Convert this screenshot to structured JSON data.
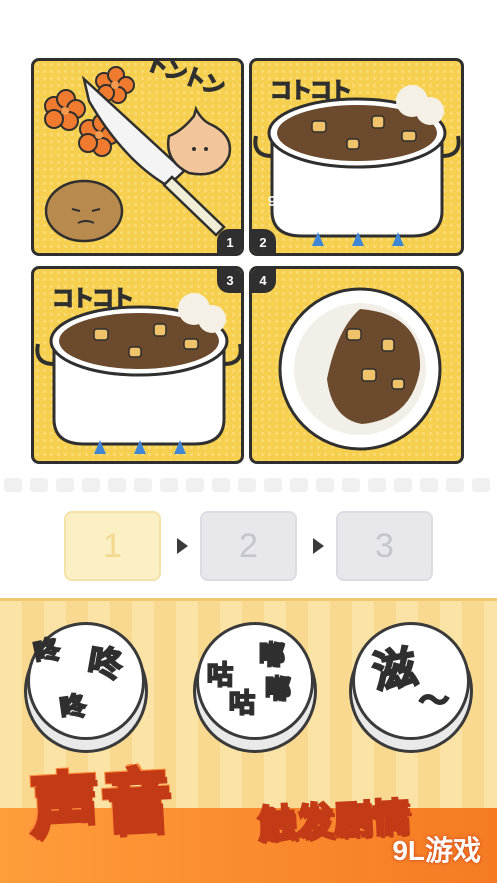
{
  "panels": [
    {
      "number": "1",
      "sfx": "トントン"
    },
    {
      "number": "2",
      "sfx": "コトコト"
    },
    {
      "number": "3",
      "sfx": "コトコト"
    },
    {
      "number": "4",
      "sfx": ""
    }
  ],
  "watermark": {
    "logo": "9L游戏",
    "url": "91danji.com"
  },
  "answer_slots": [
    "1",
    "2",
    "3"
  ],
  "sound_buttons": [
    {
      "label_parts": [
        "咚",
        "咚",
        "咚"
      ]
    },
    {
      "label_parts": [
        "咕",
        "嘟",
        "咕",
        "嘟"
      ]
    },
    {
      "label_parts": [
        "滋",
        "〜"
      ]
    }
  ],
  "banner": {
    "main": "声音",
    "sub": "触发剧情"
  },
  "corner_logo": "9L游戏",
  "colors": {
    "panel_bg": "#f6cf4f",
    "tray": "#fbe3a5",
    "accent": "#f57a23"
  }
}
